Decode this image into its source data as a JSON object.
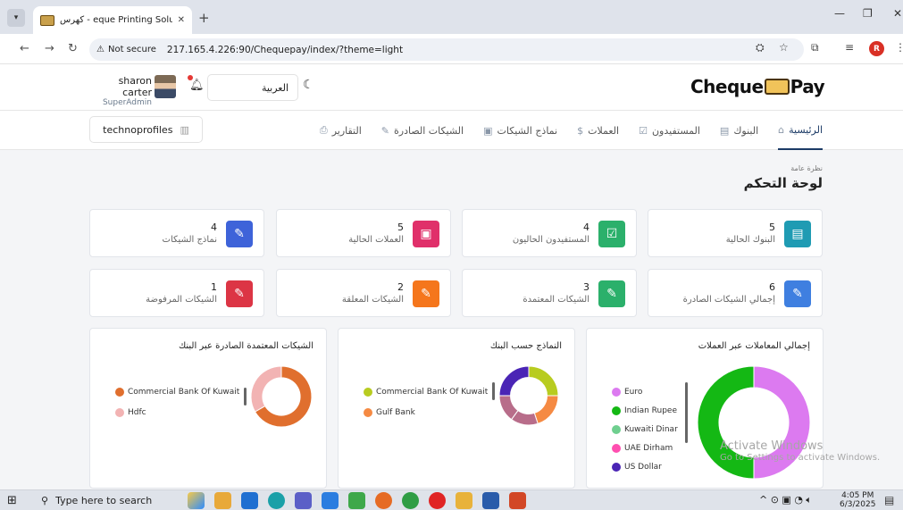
{
  "browser": {
    "tab_title": "کهرس - eque Printing Solutions",
    "close_tab": "✕",
    "new_tab": "+",
    "not_secure": "Not secure",
    "url": "217.165.4.226:90/Chequepay/index/?theme=light",
    "profile_initial": "R"
  },
  "header": {
    "user_name": "sharon carter",
    "user_role": "SuperAdmin",
    "language": "العربية",
    "logo_left": "Cheque",
    "logo_right": "Pay"
  },
  "org_selector": "technoprofiles",
  "menu": [
    {
      "label": "الرئيسية",
      "icon": "home-icon",
      "glyph": "⌂",
      "active": true
    },
    {
      "label": "البنوك",
      "icon": "bank-icon",
      "glyph": "▤",
      "active": false
    },
    {
      "label": "المستفيدون",
      "icon": "check-square-icon",
      "glyph": "☑",
      "active": false
    },
    {
      "label": "العملات",
      "icon": "dollar-icon",
      "glyph": "$",
      "active": false
    },
    {
      "label": "نماذج الشيكات",
      "icon": "template-icon",
      "glyph": "▣",
      "active": false
    },
    {
      "label": "الشيكات الصادرة",
      "icon": "pen-icon",
      "glyph": "✎",
      "active": false
    },
    {
      "label": "التقارير",
      "icon": "report-icon",
      "glyph": "⎙",
      "active": false
    }
  ],
  "page": {
    "breadcrumb": "نظرة عامة",
    "title": "لوحة التحكم"
  },
  "cards": [
    {
      "value": "5",
      "label": "البنوك الحالية",
      "color": "#1f9bb3",
      "icon": "bank-icon",
      "glyph": "▤"
    },
    {
      "value": "4",
      "label": "المستفيدون الحاليون",
      "color": "#2bb06b",
      "icon": "check-square-icon",
      "glyph": "☑"
    },
    {
      "value": "5",
      "label": "العملات الحالية",
      "color": "#e0306a",
      "icon": "currency-icon",
      "glyph": "▣"
    },
    {
      "value": "4",
      "label": "نماذج الشيكات",
      "color": "#3e63d9",
      "icon": "pen-icon",
      "glyph": "✎"
    },
    {
      "value": "6",
      "label": "إجمالي الشيكات الصادرة",
      "color": "#3f7fe0",
      "icon": "pen-icon",
      "glyph": "✎"
    },
    {
      "value": "3",
      "label": "الشيكات المعتمدة",
      "color": "#2bb06b",
      "icon": "pen-icon",
      "glyph": "✎"
    },
    {
      "value": "2",
      "label": "الشيكات المعلقة",
      "color": "#f5761c",
      "icon": "pen-icon",
      "glyph": "✎"
    },
    {
      "value": "1",
      "label": "الشيكات المرفوضة",
      "color": "#dc3545",
      "icon": "pen-icon",
      "glyph": "✎"
    }
  ],
  "chart_data": [
    {
      "type": "pie",
      "title": "إجمالي المعاملات عبر العملات",
      "categories": [
        "Euro",
        "Indian Rupee",
        "Kuwaiti Dinar",
        "UAE Dirham",
        "US Dollar"
      ],
      "values": [
        3,
        3,
        0,
        0,
        0
      ],
      "colors": [
        "#dc7af0",
        "#14b814",
        "#6fcf8f",
        "#ff4fb0",
        "#4a25b5"
      ],
      "legend": "left"
    },
    {
      "type": "pie",
      "title": "النماذج حسب البنك",
      "categories": [
        "Commercial Bank Of Kuwait",
        "Gulf Bank"
      ],
      "values": [
        25,
        20,
        15,
        15,
        25
      ],
      "colors": [
        "#b8cc20",
        "#f58a43",
        "#b86d8a",
        "#b86d8a",
        "#4a25b5"
      ],
      "legend": "left"
    },
    {
      "type": "pie",
      "title": "الشيكات المعتمدة الصادرة عبر البنك",
      "categories": [
        "Commercial Bank Of Kuwait",
        "Hdfc"
      ],
      "values": [
        2,
        1
      ],
      "colors": [
        "#e06f2e",
        "#f2b3b3"
      ],
      "legend": "left"
    }
  ],
  "watermark": {
    "line1": "Activate Windows",
    "line2": "Go to Settings to activate Windows."
  },
  "taskbar": {
    "search_placeholder": "Type here to search",
    "time": "4:05 PM",
    "date": "6/3/2025"
  }
}
